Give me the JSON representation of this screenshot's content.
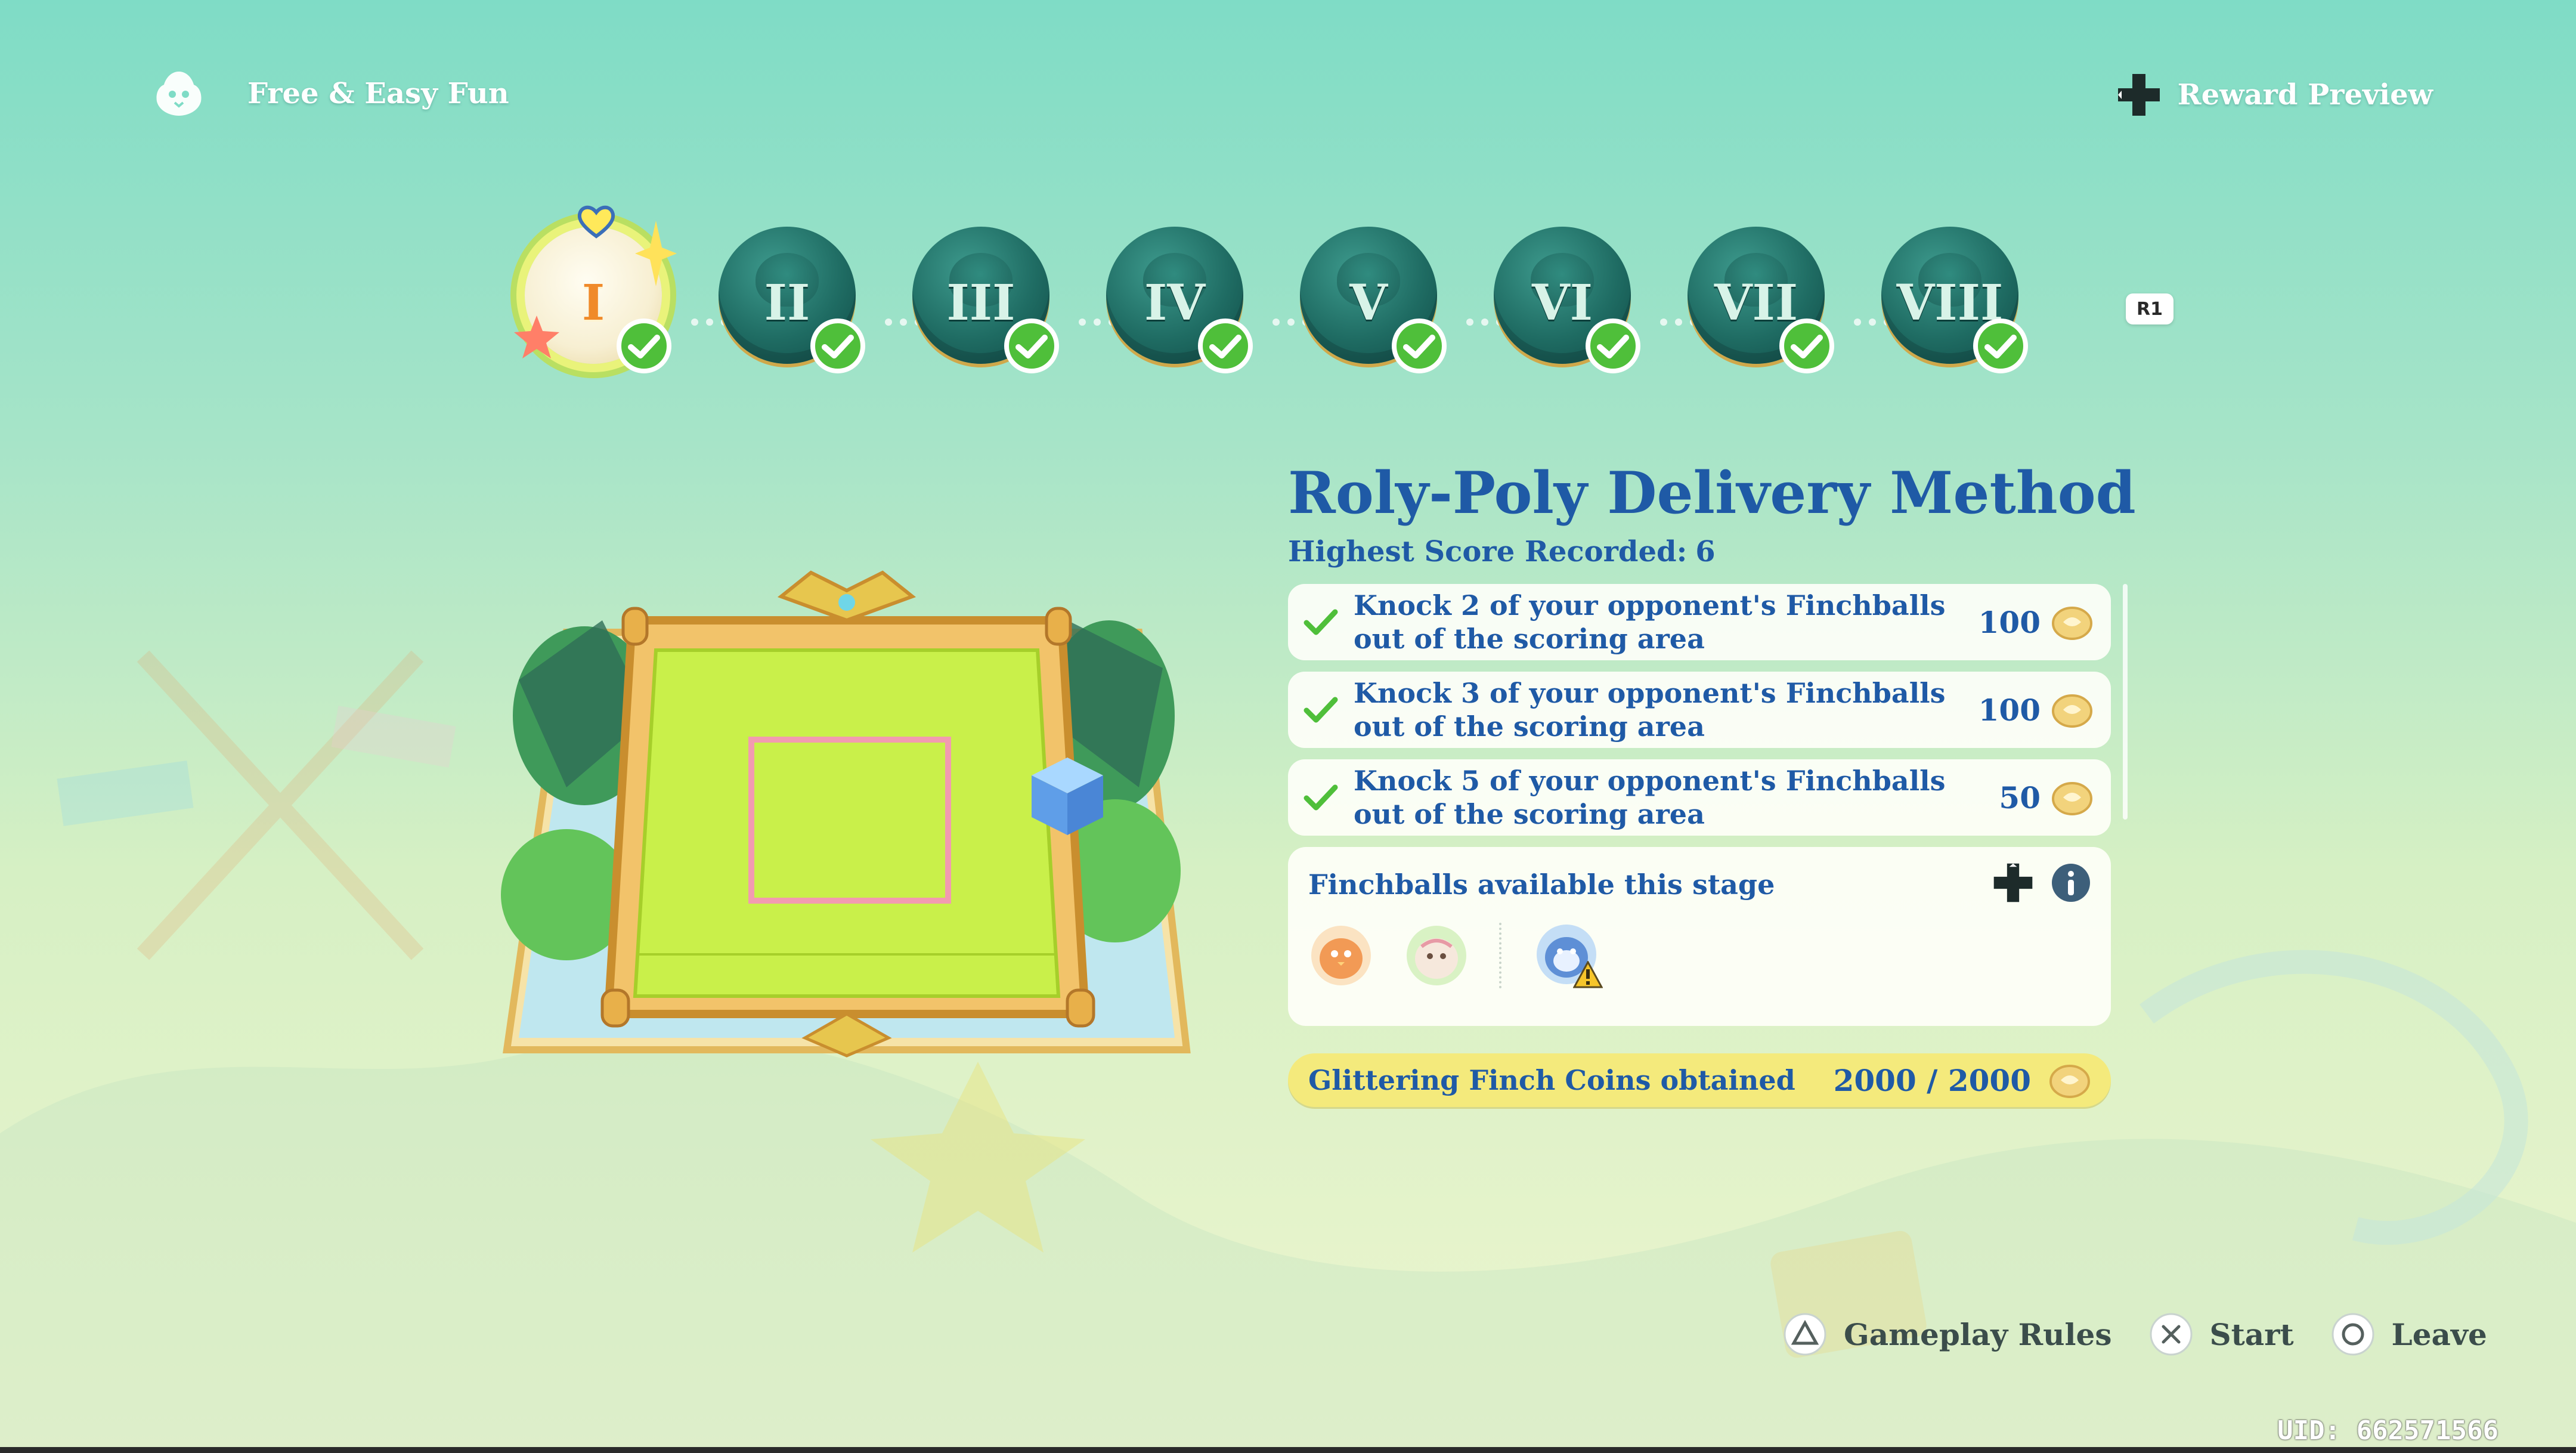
{
  "header": {
    "mode_title": "Free & Easy Fun",
    "reward_preview_label": "Reward Preview"
  },
  "stages": [
    {
      "numeral": "I",
      "completed": true,
      "selected": true
    },
    {
      "numeral": "II",
      "completed": true,
      "selected": false
    },
    {
      "numeral": "III",
      "completed": true,
      "selected": false
    },
    {
      "numeral": "IV",
      "completed": true,
      "selected": false
    },
    {
      "numeral": "V",
      "completed": true,
      "selected": false
    },
    {
      "numeral": "VI",
      "completed": true,
      "selected": false
    },
    {
      "numeral": "VII",
      "completed": true,
      "selected": false
    },
    {
      "numeral": "VIII",
      "completed": true,
      "selected": false
    }
  ],
  "next_button_label": "R1",
  "stage_detail": {
    "title": "Roly-Poly Delivery Method",
    "highest_score_label": "Highest Score Recorded:",
    "highest_score_value": "6",
    "tasks": [
      {
        "description": "Knock 2 of your opponent's Finchballs out of the scoring area",
        "reward": "100",
        "completed": true
      },
      {
        "description": "Knock 3 of your opponent's Finchballs out of the scoring area",
        "reward": "100",
        "completed": true
      },
      {
        "description": "Knock 5 of your opponent's Finchballs out of the scoring area",
        "reward": "50",
        "completed": true
      }
    ],
    "finchballs_label": "Finchballs available this stage",
    "finchballs": [
      "orange-finchball-icon",
      "green-finchball-icon",
      "blue-finchball-icon"
    ],
    "coins_label": "Glittering Finch Coins obtained",
    "coins_value": "2000 / 2000"
  },
  "controls": {
    "gameplay_rules": "Gameplay Rules",
    "start": "Start",
    "leave": "Leave"
  },
  "uid": "UID: 662571566",
  "colors": {
    "title_blue": "#1f5aa6",
    "check_green": "#4fbf3a",
    "coin_bar": "#f4ea7c"
  }
}
